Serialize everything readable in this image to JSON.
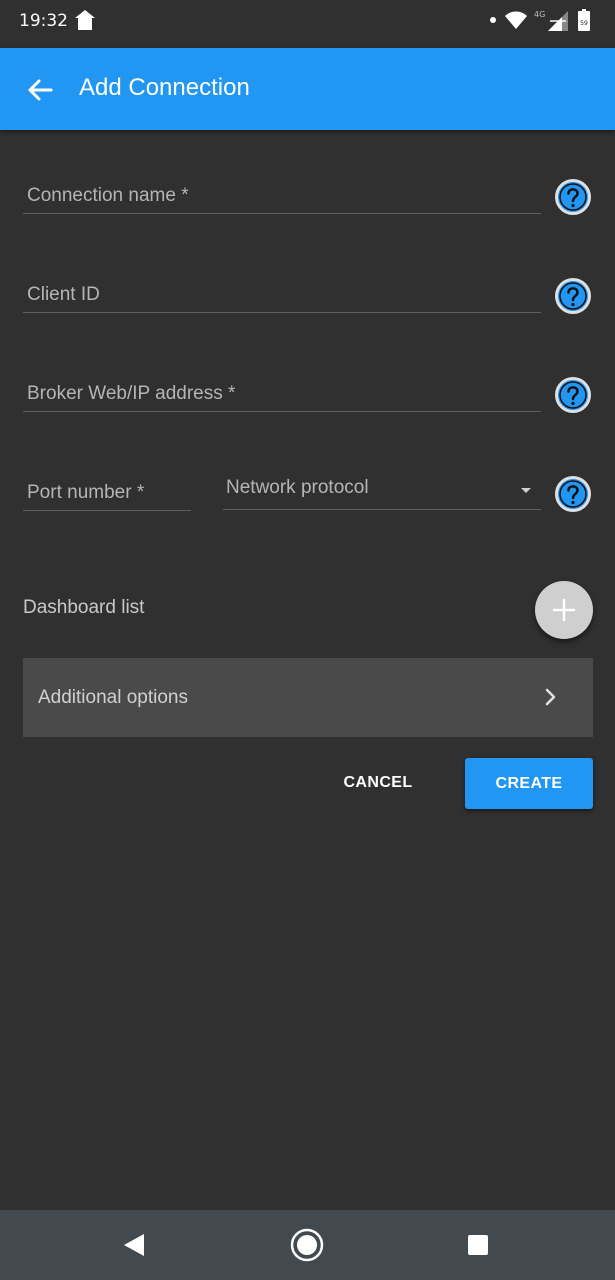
{
  "status_bar": {
    "time": "19:32",
    "network_type": "4G",
    "battery_level": "59",
    "icons": [
      "home-icon",
      "notification-dot-icon",
      "wifi-icon",
      "cell-signal-icon",
      "battery-icon"
    ]
  },
  "app_bar": {
    "title": "Add Connection",
    "back_icon": "arrow-left-icon"
  },
  "form": {
    "connection_name": {
      "label": "Connection name *",
      "value": ""
    },
    "client_id": {
      "label": "Client ID",
      "value": ""
    },
    "broker_address": {
      "label": "Broker Web/IP address *",
      "value": ""
    },
    "port_number": {
      "label": "Port number *",
      "value": ""
    },
    "network_protocol": {
      "label": "Network protocol",
      "value": ""
    },
    "help_icon": "help-circle-icon"
  },
  "dashboard": {
    "label": "Dashboard list",
    "add_icon": "plus-icon"
  },
  "additional_options": {
    "label": "Additional options",
    "icon": "chevron-right-icon"
  },
  "actions": {
    "cancel_label": "CANCEL",
    "create_label": "CREATE"
  },
  "colors": {
    "accent": "#2196f3",
    "background": "#303030",
    "panel": "#4a4a4a",
    "nav_bar": "#434a4f"
  },
  "nav_bar": {
    "icons": [
      "back-triangle-icon",
      "home-circle-icon",
      "recents-square-icon"
    ]
  }
}
